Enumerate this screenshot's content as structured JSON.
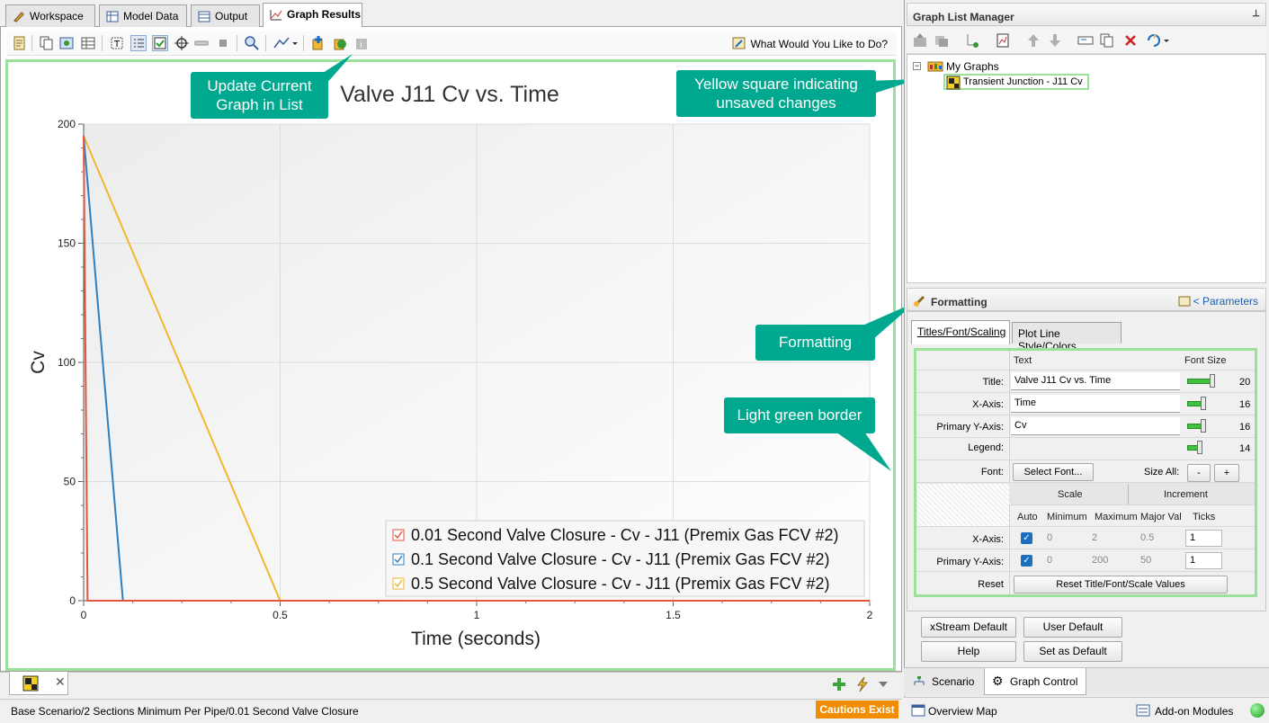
{
  "tabs": [
    "Workspace",
    "Model Data",
    "Output",
    "Graph Results"
  ],
  "toolbar": {
    "help_link": "What Would You Like to Do?"
  },
  "callouts": {
    "update": "Update Current Graph in List",
    "yellow": "Yellow square indicating unsaved changes",
    "formatting": "Formatting",
    "green_border": "Light green border"
  },
  "status": {
    "path": "Base Scenario/2 Sections Minimum Per Pipe/0.01 Second Valve Closure",
    "cautions": "Cautions Exist"
  },
  "graph_list": {
    "title": "Graph List Manager",
    "root": "My Graphs",
    "item": "Transient Junction - J11 Cv"
  },
  "formatting": {
    "title": "Formatting",
    "parameters_link": "< Parameters",
    "tabs": [
      "Titles/Font/Scaling",
      "Plot Line Style/Colors"
    ],
    "col_text": "Text",
    "col_font_size": "Font Size",
    "rows": [
      {
        "label": "Title:",
        "text": "Valve J11 Cv vs. Time",
        "size": "20",
        "level": 20
      },
      {
        "label": "X-Axis:",
        "text": "Time",
        "size": "16",
        "level": 16
      },
      {
        "label": "Primary Y-Axis:",
        "text": "Cv",
        "size": "16",
        "level": 16
      },
      {
        "label": "Legend:",
        "text": "",
        "size": "14",
        "level": 14
      }
    ],
    "font_label": "Font:",
    "select_font": "Select Font...",
    "size_all": "Size All:",
    "minus": "-",
    "plus": "+",
    "scale_hdr": "Scale",
    "increment_hdr": "Increment",
    "sub_hdrs": [
      "Auto",
      "Minimum",
      "Maximum",
      "Major Val",
      "Ticks"
    ],
    "xaxis": {
      "label": "X-Axis:",
      "min": "0",
      "max": "2",
      "major": "0.5",
      "ticks": "1"
    },
    "yaxis": {
      "label": "Primary Y-Axis:",
      "min": "0",
      "max": "200",
      "major": "50",
      "ticks": "1"
    },
    "reset_label": "Reset",
    "reset_button": "Reset Title/Font/Scale Values"
  },
  "buttons": {
    "xstream_default": "xStream Default",
    "user_default": "User Default",
    "help": "Help",
    "set_as_default": "Set as Default"
  },
  "right_tabs": [
    "Scenario",
    "Graph Control"
  ],
  "right_status": {
    "overview": "Overview Map",
    "addons": "Add-on Modules"
  },
  "chart_data": {
    "type": "line",
    "title": "Valve J11 Cv vs. Time",
    "xlabel": "Time (seconds)",
    "ylabel": "Cv",
    "xlim": [
      0,
      2
    ],
    "ylim": [
      0,
      200
    ],
    "xticks": [
      0,
      0.5,
      1,
      1.5,
      2
    ],
    "yticks": [
      0,
      50,
      100,
      150,
      200
    ],
    "grid": true,
    "legend_position": "bottom-right",
    "series": [
      {
        "name": "0.01 Second Valve Closure - Cv - J11 (Premix Gas FCV #2)",
        "color": "#e2553f",
        "x": [
          0,
          0.01,
          2
        ],
        "y": [
          195,
          0,
          0
        ]
      },
      {
        "name": "0.1 Second Valve Closure - Cv - J11 (Premix Gas FCV #2)",
        "color": "#2f7fbf",
        "x": [
          0,
          0.1,
          2
        ],
        "y": [
          195,
          0,
          0
        ]
      },
      {
        "name": "0.5 Second Valve Closure - Cv - J11 (Premix Gas FCV #2)",
        "color": "#f2b630",
        "x": [
          0,
          0.5,
          2
        ],
        "y": [
          195,
          0,
          0
        ]
      }
    ]
  }
}
